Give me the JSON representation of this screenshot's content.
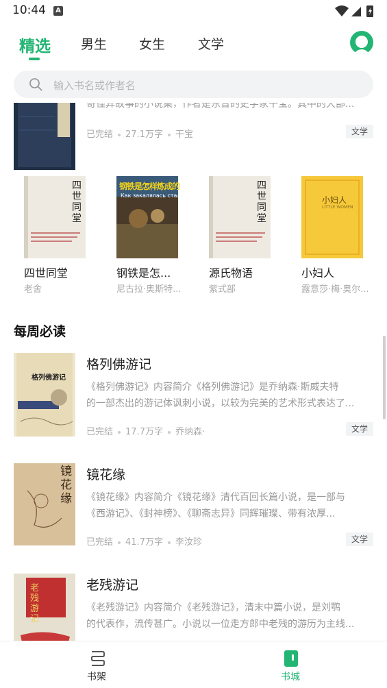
{
  "status_bar": {
    "time": "10:44",
    "notification_letter": "A"
  },
  "top_tabs": [
    {
      "label": "精选",
      "active": true
    },
    {
      "label": "男生",
      "active": false
    },
    {
      "label": "女生",
      "active": false
    },
    {
      "label": "文学",
      "active": false
    }
  ],
  "search": {
    "placeholder": "输入书名或作者名"
  },
  "partial_book": {
    "desc": "奇怪异故事的小说集，作者是东晋的史学家干宝。其中的大部...",
    "status": "已完结",
    "words": "27.1万字",
    "author": "干宝",
    "tag": "文学"
  },
  "grid_books": [
    {
      "title": "四世同堂",
      "author": "老舍"
    },
    {
      "title": "钢铁是怎...",
      "author": "尼古拉·奥斯特..."
    },
    {
      "title": "源氏物语",
      "author": "紫式部"
    },
    {
      "title": "小妇人",
      "author": "露意莎·梅·奥尔..."
    }
  ],
  "cover_text": {
    "sishi": "四世同堂",
    "gangtie": "钢铁是怎样炼成的",
    "gangtie_sub": "Как закалялась сталь",
    "xiaofuren": "小妇人",
    "xiaofuren_sub": "LITTLE WOMEN",
    "geliefo": "格列佛游记",
    "jinghua": "镜花缘",
    "laocan": "老残游记"
  },
  "weekly_section": {
    "title": "每周必读"
  },
  "weekly_books": [
    {
      "title": "格列佛游记",
      "desc_line1": "《格列佛游记》内容简介《格列佛游记》是乔纳森·斯威夫特",
      "desc_line2": "的一部杰出的游记体讽刺小说，以较为完美的艺术形式表达了...",
      "status": "已完结",
      "words": "17.7万字",
      "author": "乔纳森·",
      "tag": "文学"
    },
    {
      "title": "镜花缘",
      "desc_line1": "《镜花缘》内容简介《镜花缘》清代百回长篇小说，是一部与",
      "desc_line2": "《西游记》、《封神榜》、《聊斋志异》同辉璀璨、带有浓厚...",
      "status": "已完结",
      "words": "41.7万字",
      "author": "李汝珍",
      "tag": "文学"
    },
    {
      "title": "老残游记",
      "desc_line1": "《老残游记》内容简介《老残游记》，清末中篇小说，是刘鹗",
      "desc_line2": "的代表作，流传甚广。小说以一位走方郎中老残的游历为主线..."
    }
  ],
  "bottom_nav": [
    {
      "label": "书架",
      "icon": "bookshelf-icon",
      "active": false
    },
    {
      "label": "书城",
      "icon": "bookstore-icon",
      "active": true
    }
  ],
  "colors": {
    "accent": "#22b573",
    "text_primary": "#222222",
    "text_secondary": "#999999"
  }
}
